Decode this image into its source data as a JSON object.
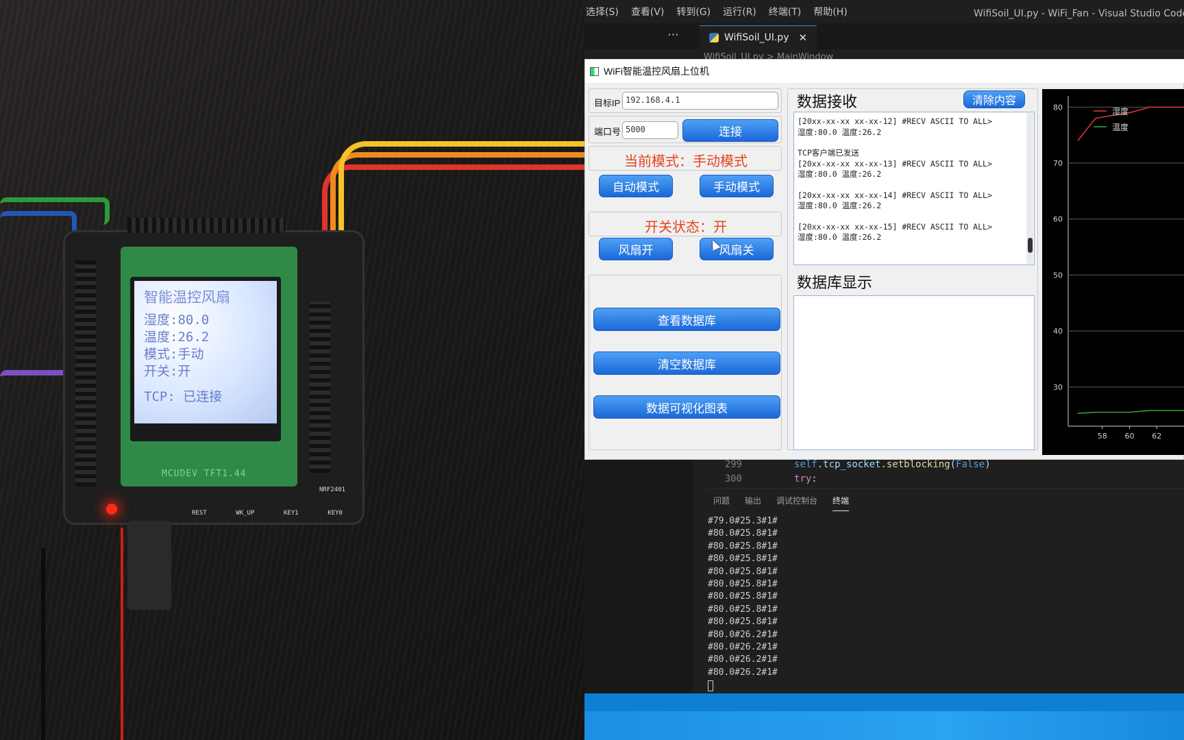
{
  "device_lcd": {
    "title": "智能温控风扇",
    "humidity": "湿度:80.0",
    "temperature": "温度:26.2",
    "mode": "模式:手动",
    "switch": "开关:开",
    "tcp": "TCP: 已连接",
    "pcb_label": "MCUDEV TFT1.44",
    "key_labels": [
      "REST",
      "WK_UP",
      "KEY1",
      "KEY0"
    ],
    "module_label": "NRF2401"
  },
  "vscode": {
    "menu": [
      "选择(S)",
      "查看(V)",
      "转到(G)",
      "运行(R)",
      "终端(T)",
      "帮助(H)"
    ],
    "window_title": "WifiSoil_UI.py - WiFi_Fan - Visual Studio Code [管理",
    "tab_label": "WifiSoil_UI.py",
    "breadcrumb": "WifiSoil_UI.py > MainWindow",
    "code_lines": [
      {
        "num": "299",
        "text": "self.tcp_socket.setblocking(False)"
      },
      {
        "num": "300",
        "text": "try:"
      }
    ],
    "panel_tabs": [
      "问题",
      "输出",
      "调试控制台",
      "终端"
    ],
    "terminal_lines": [
      "#79.0#25.3#1#",
      "#80.0#25.8#1#",
      "#80.0#25.8#1#",
      "#80.0#25.8#1#",
      "#80.0#25.8#1#",
      "#80.0#25.8#1#",
      "#80.0#25.8#1#",
      "#80.0#25.8#1#",
      "#80.0#25.8#1#",
      "#80.0#26.2#1#",
      "#80.0#26.2#1#",
      "#80.0#26.2#1#",
      "#80.0#26.2#1#"
    ]
  },
  "app": {
    "title": "WiFi智能温控风扇上位机",
    "ip_label": "目标IP",
    "ip_value": "192.168.4.1",
    "port_label": "端口号",
    "port_value": "5000",
    "connect_btn": "连接",
    "mode_status": "当前模式：手动模式",
    "auto_btn": "自动模式",
    "manual_btn": "手动模式",
    "switch_status": "开关状态：开",
    "fan_on_btn": "风扇开",
    "fan_off_btn": "风扇关",
    "view_db_btn": "查看数据库",
    "clear_db_btn": "清空数据库",
    "chart_btn": "数据可视化图表",
    "recv_header": "数据接收",
    "clear_btn": "清除内容",
    "recv_lines": [
      "[20xx-xx-xx xx-xx-12] #RECV ASCII TO ALL>",
      "湿度:80.0 温度:26.2",
      "",
      "TCP客户端已发送",
      "[20xx-xx-xx xx-xx-13] #RECV ASCII TO ALL>",
      "湿度:80.0 温度:26.2",
      "",
      "[20xx-xx-xx xx-xx-14] #RECV ASCII TO ALL>",
      "湿度:80.0 温度:26.2",
      "",
      "[20xx-xx-xx xx-xx-15] #RECV ASCII TO ALL>",
      "湿度:80.0 温度:26.2"
    ],
    "db_header": "数据库显示"
  },
  "chart_data": {
    "type": "line",
    "x_ticks": [
      58,
      60,
      62
    ],
    "y_ticks": [
      80,
      70,
      60,
      50,
      40,
      30
    ],
    "ylim": [
      23,
      82
    ],
    "xlim": [
      55.5,
      64
    ],
    "legend": [
      "湿度",
      "温度"
    ],
    "series": [
      {
        "name": "湿度",
        "color": "#e23b3b",
        "x": [
          56.2,
          57.5,
          60,
          61.5,
          62.5,
          64
        ],
        "y": [
          74,
          78,
          79,
          80,
          80,
          80
        ]
      },
      {
        "name": "温度",
        "color": "#3aa83a",
        "x": [
          56.2,
          57.5,
          60,
          61.5,
          62.5,
          64
        ],
        "y": [
          25.3,
          25.5,
          25.5,
          25.8,
          25.8,
          25.8
        ]
      }
    ]
  }
}
